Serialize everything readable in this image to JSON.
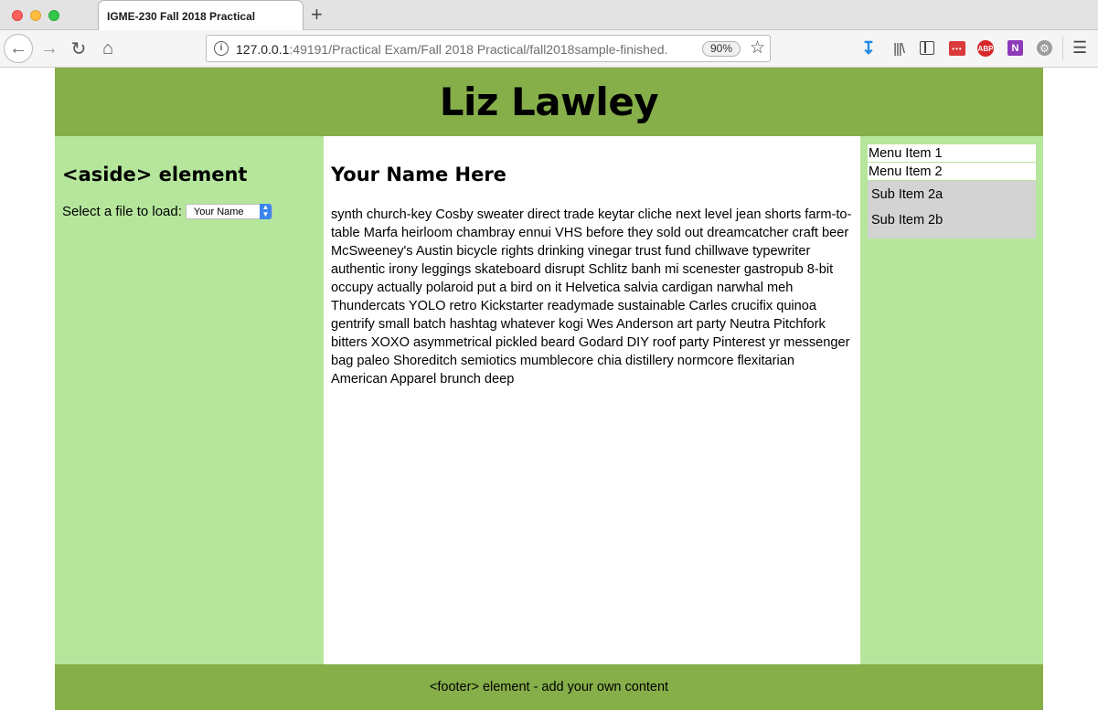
{
  "browser": {
    "tab_title": "IGME-230 Fall 2018 Practical",
    "new_tab_glyph": "+",
    "url_host": "127.0.0.1",
    "url_rest": ":49191/Practical Exam/Fall 2018 Practical/fall2018sample-finished.",
    "zoom": "90%",
    "icons": [
      "back-icon",
      "forward-icon",
      "reload-icon",
      "home-icon",
      "info-icon",
      "bookmark-star-icon",
      "download-icon",
      "library-icon",
      "sidebar-icon",
      "pocket-icon",
      "adblock-icon",
      "onenote-icon",
      "extension-icon",
      "hamburger-menu-icon"
    ],
    "abp_label": "ABP",
    "onenote_label": "N"
  },
  "page": {
    "header_title": "Liz Lawley",
    "aside_heading": "<aside> element",
    "loader_label": "Select a file to load:",
    "loader_selected": "Your Name",
    "main_heading": "Your Name Here",
    "main_body": "synth church-key Cosby sweater direct trade keytar cliche next level jean shorts farm-to-table Marfa heirloom chambray ennui VHS before they sold out dreamcatcher craft beer McSweeney's Austin bicycle rights drinking vinegar trust fund chillwave typewriter authentic irony leggings skateboard disrupt Schlitz banh mi scenester gastropub 8-bit occupy actually polaroid put a bird on it Helvetica salvia cardigan narwhal meh Thundercats YOLO retro Kickstarter readymade sustainable Carles crucifix quinoa gentrify small batch hashtag whatever kogi Wes Anderson art party Neutra Pitchfork bitters XOXO asymmetrical pickled beard Godard DIY roof party Pinterest yr messenger bag paleo Shoreditch semiotics mumblecore chia distillery normcore flexitarian American Apparel brunch deep",
    "menu": {
      "item1": "Menu Item 1",
      "item2": "Menu Item 2",
      "sub_a": "Sub Item 2a",
      "sub_b": "Sub Item 2b"
    },
    "footer_text": "<footer> element - add your own content"
  },
  "colors": {
    "header_footer_green": "#86af49",
    "aside_green": "#b5e69c",
    "submenu_gray": "#d3d3d3"
  }
}
